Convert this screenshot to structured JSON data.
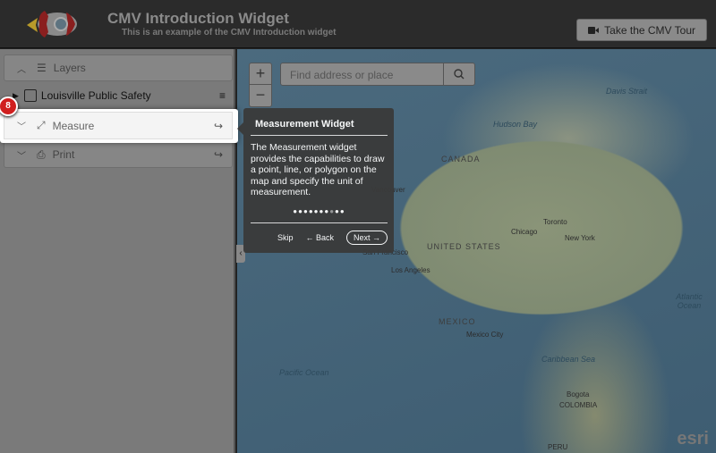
{
  "header": {
    "title": "CMV Introduction Widget",
    "subtitle": "This is an example of the CMV Introduction widget",
    "tour_button": "Take the CMV Tour",
    "tour_icon": "video-camera-icon"
  },
  "sidebar": {
    "layers": {
      "label": "Layers",
      "items": [
        {
          "label": "Louisville Public Safety",
          "checked": false
        }
      ]
    },
    "measure": {
      "label": "Measure"
    },
    "print": {
      "label": "Print"
    }
  },
  "map": {
    "search_placeholder": "Find address or place",
    "zoom_in": "+",
    "zoom_out": "−",
    "labels": {
      "davis": "Davis Strait",
      "hudson": "Hudson Bay",
      "canada": "CANADA",
      "vancouver": "Vancouver",
      "toronto": "Toronto",
      "chicago": "Chicago",
      "newyork": "New York",
      "us": "UNITED STATES",
      "sf": "San Francisco",
      "la": "Los Angeles",
      "atlantic": "Atlantic Ocean",
      "mexico": "MEXICO",
      "mexicocity": "Mexico City",
      "caribbean": "Caribbean Sea",
      "pacific": "Pacific Ocean",
      "bogota": "Bogota",
      "colombia": "COLOMBIA",
      "peru": "PERU"
    },
    "attribution": "esri"
  },
  "tour": {
    "step": "8",
    "title": "Measurement Widget",
    "body": "The Measurement widget provides the capabilities to draw a point, line, or polygon on the map and specify the unit of measurement.",
    "total_steps": 10,
    "current_step": 8,
    "skip": "Skip",
    "back": "← Back",
    "next": "Next →"
  }
}
